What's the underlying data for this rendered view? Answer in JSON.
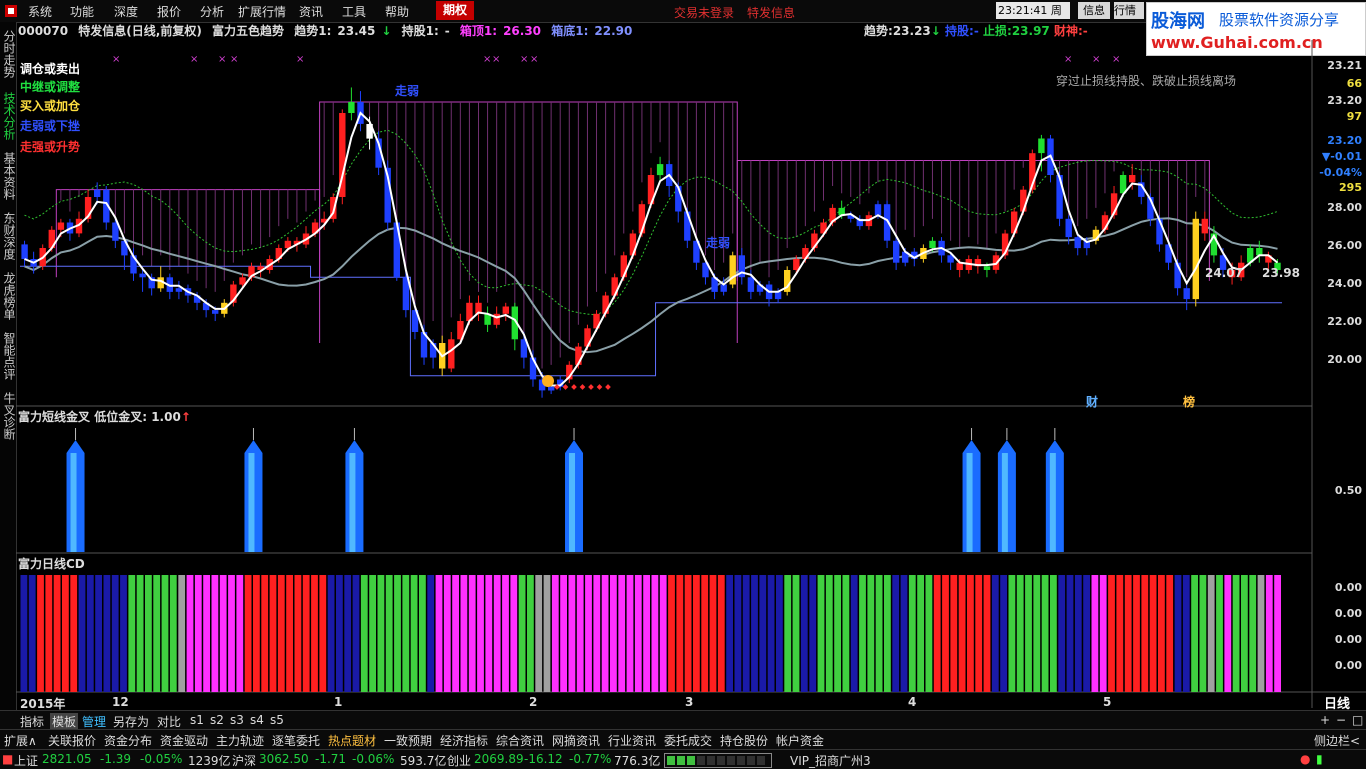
{
  "menu": {
    "items": [
      "系统",
      "功能",
      "深度",
      "报价",
      "分析",
      "扩展行情",
      "资讯",
      "工具",
      "帮助"
    ],
    "futures_tab": "期权",
    "not_logged": "交易未登录",
    "special": "特发信息",
    "clock": "23:21:41",
    "weekday": "周日",
    "info_btn": "信息",
    "quote_btn": "行情"
  },
  "watermark": {
    "brand": "股海网",
    "slogan": "股票软件资源分享",
    "url": "www.Guhai.com.cn"
  },
  "left_tabs": [
    "分时走势",
    "技术分析",
    "基本资料",
    "东财深度",
    "龙虎榜单",
    "智能点评",
    "牛叉诊断"
  ],
  "info_line": {
    "code": "000070",
    "name": "特发信息(日线,前复权)",
    "indicator": "富力五色趋势",
    "trend1_label": "趋势1:",
    "trend1_value": "23.45",
    "hold1_label": "持股1:",
    "hold1_value": "-",
    "boxtop1_label": "箱顶1:",
    "boxtop1_value": "26.30",
    "boxbottom1_label": "箱底1:",
    "boxbottom1_value": "22.90",
    "trend_label": "趋势:",
    "trend_value": "23.23",
    "hold_label": "持股:",
    "hold_value": "-",
    "stop_label": "止损:",
    "stop_value": "23.97",
    "god_label": "财神:",
    "god_value": "-"
  },
  "legend": [
    {
      "text": "调仓或卖出",
      "color": "#ffffff"
    },
    {
      "text": "中继或调整",
      "color": "#20e040"
    },
    {
      "text": "买入或加仓",
      "color": "#ffe040"
    },
    {
      "text": "走弱或下挫",
      "color": "#3050ff"
    },
    {
      "text": "走强或升势",
      "color": "#ff3030"
    }
  ],
  "annotations": {
    "note": "穿过止损线持股、跌破止损线离场",
    "weak1": "走弱",
    "weak2": "走弱",
    "label_a": "24.07",
    "label_b": "23.98",
    "finance_mark": "财",
    "rank_mark": "榜"
  },
  "price_axis": [
    "23.21",
    "66",
    "23.20",
    "97",
    "23.20",
    "-0.01",
    "-0.04%",
    "295",
    "28.00",
    "26.00",
    "24.00",
    "22.00",
    "20.00"
  ],
  "panel2": {
    "title": "富力短线金叉",
    "sub_label": "低位金叉:",
    "sub_value": "1.00",
    "axis": "0.50"
  },
  "panel3": {
    "title": "富力日线CD",
    "axis": [
      "0.00",
      "0.00",
      "0.00",
      "0.00"
    ]
  },
  "date_axis": {
    "year": "2015年",
    "labels": [
      "12",
      "1",
      "2",
      "3",
      "4",
      "5"
    ],
    "period": "日线"
  },
  "toolbar": [
    "指标",
    "模板",
    "管理",
    "另存为",
    "对比",
    "s1",
    "s2",
    "s3",
    "s4",
    "s5"
  ],
  "toolbar_right": [
    "+",
    "−",
    "□"
  ],
  "bottom_tabs": [
    "扩展∧",
    "关联报价",
    "资金分布",
    "资金驱动",
    "主力轨迹",
    "逐笔委托",
    "热点题材",
    "一致预期",
    "经济指标",
    "综合资讯",
    "网摘资讯",
    "行业资讯",
    "委托成交",
    "持仓股份",
    "帐户资金"
  ],
  "bottom_right": "侧边栏<",
  "status": {
    "sh_label": "上证",
    "sh_value": "2821.05",
    "sh_change": "-1.39",
    "sh_pct": "-0.05%",
    "sh_amount": "1239亿",
    "hs_label": "沪深",
    "hs_value": "3062.50",
    "hs_change": "-1.71",
    "hs_pct": "-0.06%",
    "hs_amount": "593.7亿",
    "cy_label": "创业",
    "cy_value": "2069.89",
    "cy_change": "-16.12",
    "cy_pct": "-0.77%",
    "cy_amount": "776.3亿",
    "vip": "VIP_招商广州3"
  },
  "chart_data": {
    "type": "candlestick",
    "ylim": [
      19.5,
      29.5
    ],
    "candles": [
      [
        23.9,
        23.5,
        24.0,
        23.3,
        "b"
      ],
      [
        23.5,
        23.3,
        23.7,
        23.1,
        "b"
      ],
      [
        23.3,
        23.8,
        23.9,
        23.2,
        "r"
      ],
      [
        23.8,
        24.3,
        24.4,
        23.7,
        "r"
      ],
      [
        24.3,
        24.5,
        24.6,
        24.1,
        "r"
      ],
      [
        24.5,
        24.2,
        24.6,
        24.0,
        "b"
      ],
      [
        24.2,
        24.6,
        24.8,
        24.1,
        "r"
      ],
      [
        24.6,
        25.2,
        25.4,
        24.5,
        "r"
      ],
      [
        25.2,
        25.4,
        25.6,
        25.0,
        "b"
      ],
      [
        25.4,
        24.5,
        25.5,
        24.3,
        "b"
      ],
      [
        24.5,
        24.0,
        24.6,
        23.8,
        "b"
      ],
      [
        24.0,
        23.6,
        24.1,
        23.2,
        "b"
      ],
      [
        23.6,
        23.1,
        23.8,
        22.9,
        "b"
      ],
      [
        23.1,
        23.0,
        23.2,
        22.6,
        "b"
      ],
      [
        23.0,
        22.7,
        23.1,
        22.5,
        "b"
      ],
      [
        22.7,
        23.0,
        23.3,
        22.6,
        "y"
      ],
      [
        23.0,
        22.6,
        23.1,
        22.4,
        "b"
      ],
      [
        22.6,
        22.7,
        22.9,
        22.4,
        "b"
      ],
      [
        22.7,
        22.5,
        22.8,
        22.3,
        "b"
      ],
      [
        22.5,
        22.3,
        22.6,
        22.1,
        "b"
      ],
      [
        22.3,
        22.1,
        22.4,
        21.9,
        "b"
      ],
      [
        22.1,
        22.0,
        22.2,
        21.8,
        "b"
      ],
      [
        22.0,
        22.3,
        22.4,
        21.9,
        "y"
      ],
      [
        22.3,
        22.8,
        22.9,
        22.2,
        "r"
      ],
      [
        22.8,
        23.0,
        23.1,
        22.7,
        "r"
      ],
      [
        23.0,
        23.3,
        23.4,
        22.9,
        "r"
      ],
      [
        23.3,
        23.2,
        23.4,
        23.0,
        "r"
      ],
      [
        23.2,
        23.5,
        23.6,
        23.1,
        "r"
      ],
      [
        23.5,
        23.8,
        23.9,
        23.4,
        "r"
      ],
      [
        23.8,
        24.0,
        24.1,
        23.7,
        "r"
      ],
      [
        24.0,
        23.9,
        24.1,
        23.7,
        "r"
      ],
      [
        23.9,
        24.2,
        24.4,
        23.8,
        "r"
      ],
      [
        24.2,
        24.5,
        24.6,
        24.1,
        "r"
      ],
      [
        24.5,
        24.6,
        24.8,
        24.3,
        "r"
      ],
      [
        24.6,
        25.2,
        25.3,
        24.5,
        "r"
      ],
      [
        25.2,
        27.5,
        27.6,
        25.0,
        "r"
      ],
      [
        27.5,
        27.8,
        28.2,
        27.3,
        "g"
      ],
      [
        27.8,
        27.2,
        28.1,
        27.0,
        "b"
      ],
      [
        27.2,
        26.8,
        27.4,
        26.5,
        "w"
      ],
      [
        26.8,
        26.0,
        27.0,
        25.8,
        "b"
      ],
      [
        26.0,
        24.5,
        26.2,
        24.3,
        "b"
      ],
      [
        24.5,
        23.0,
        24.6,
        22.9,
        "b"
      ],
      [
        23.0,
        22.1,
        23.2,
        21.9,
        "b"
      ],
      [
        22.1,
        21.5,
        22.3,
        21.3,
        "b"
      ],
      [
        21.5,
        20.8,
        21.7,
        20.6,
        "b"
      ],
      [
        20.8,
        21.2,
        21.3,
        20.5,
        "b"
      ],
      [
        21.2,
        20.5,
        21.4,
        20.3,
        "y"
      ],
      [
        20.5,
        21.3,
        21.5,
        20.4,
        "r"
      ],
      [
        21.3,
        21.8,
        22.0,
        21.2,
        "r"
      ],
      [
        21.8,
        22.3,
        22.5,
        21.7,
        "r"
      ],
      [
        22.3,
        22.0,
        22.5,
        21.8,
        "r"
      ],
      [
        22.0,
        21.7,
        22.2,
        21.5,
        "g"
      ],
      [
        21.7,
        22.0,
        22.2,
        21.6,
        "r"
      ],
      [
        22.0,
        22.2,
        22.3,
        21.8,
        "r"
      ],
      [
        22.2,
        21.3,
        22.3,
        21.0,
        "g"
      ],
      [
        21.3,
        20.8,
        21.5,
        20.5,
        "b"
      ],
      [
        20.8,
        20.2,
        21.0,
        20.0,
        "b"
      ],
      [
        20.2,
        19.9,
        20.4,
        19.7,
        "b"
      ],
      [
        19.9,
        20.0,
        20.2,
        19.8,
        "b"
      ],
      [
        20.0,
        20.2,
        20.3,
        19.9,
        "b"
      ],
      [
        20.2,
        20.6,
        20.7,
        20.1,
        "r"
      ],
      [
        20.6,
        21.1,
        21.2,
        20.5,
        "r"
      ],
      [
        21.1,
        21.6,
        21.7,
        21.0,
        "r"
      ],
      [
        21.6,
        22.0,
        22.1,
        21.5,
        "r"
      ],
      [
        22.0,
        22.5,
        22.6,
        21.9,
        "r"
      ],
      [
        22.5,
        23.0,
        23.1,
        22.4,
        "r"
      ],
      [
        23.0,
        23.6,
        23.7,
        22.9,
        "r"
      ],
      [
        23.6,
        24.2,
        24.3,
        23.5,
        "r"
      ],
      [
        24.2,
        25.0,
        25.1,
        24.1,
        "r"
      ],
      [
        25.0,
        25.8,
        26.0,
        24.9,
        "r"
      ],
      [
        25.8,
        26.1,
        26.3,
        25.6,
        "g"
      ],
      [
        26.1,
        25.5,
        26.2,
        25.2,
        "b"
      ],
      [
        25.5,
        24.8,
        25.6,
        24.5,
        "b"
      ],
      [
        24.8,
        24.0,
        24.9,
        23.8,
        "b"
      ],
      [
        24.0,
        23.4,
        24.1,
        23.2,
        "b"
      ],
      [
        23.4,
        23.0,
        23.5,
        22.8,
        "b"
      ],
      [
        23.0,
        22.6,
        23.1,
        22.4,
        "b"
      ],
      [
        22.6,
        22.8,
        23.0,
        22.5,
        "b"
      ],
      [
        22.8,
        23.6,
        23.7,
        22.7,
        "y"
      ],
      [
        23.6,
        23.0,
        23.8,
        22.8,
        "b"
      ],
      [
        23.0,
        22.6,
        23.2,
        22.4,
        "b"
      ],
      [
        22.6,
        22.8,
        22.9,
        22.5,
        "b"
      ],
      [
        22.8,
        22.4,
        22.9,
        22.2,
        "b"
      ],
      [
        22.4,
        22.6,
        22.7,
        22.3,
        "b"
      ],
      [
        22.6,
        23.2,
        23.3,
        22.5,
        "y"
      ],
      [
        23.2,
        23.5,
        23.6,
        23.1,
        "r"
      ],
      [
        23.5,
        23.8,
        23.9,
        23.4,
        "r"
      ],
      [
        23.8,
        24.2,
        24.3,
        23.7,
        "r"
      ],
      [
        24.2,
        24.5,
        24.6,
        24.1,
        "r"
      ],
      [
        24.5,
        24.9,
        25.0,
        24.4,
        "r"
      ],
      [
        24.9,
        24.7,
        25.1,
        24.6,
        "g"
      ],
      [
        24.7,
        24.6,
        24.8,
        24.5,
        "b"
      ],
      [
        24.6,
        24.4,
        24.7,
        24.3,
        "b"
      ],
      [
        24.4,
        24.7,
        24.8,
        24.3,
        "r"
      ],
      [
        24.7,
        25.0,
        25.1,
        24.6,
        "b"
      ],
      [
        25.0,
        24.0,
        25.1,
        23.8,
        "b"
      ],
      [
        24.0,
        23.4,
        24.1,
        23.2,
        "b"
      ],
      [
        23.4,
        23.7,
        23.8,
        23.3,
        "b"
      ],
      [
        23.7,
        23.5,
        23.8,
        23.3,
        "b"
      ],
      [
        23.5,
        23.8,
        23.9,
        23.4,
        "y"
      ],
      [
        23.8,
        24.0,
        24.1,
        23.7,
        "g"
      ],
      [
        24.0,
        23.6,
        24.1,
        23.4,
        "b"
      ],
      [
        23.6,
        23.4,
        23.7,
        23.2,
        "b"
      ],
      [
        23.4,
        23.2,
        23.5,
        23.0,
        "r"
      ],
      [
        23.2,
        23.5,
        23.6,
        23.1,
        "r"
      ],
      [
        23.5,
        23.3,
        23.6,
        23.1,
        "r"
      ],
      [
        23.3,
        23.2,
        23.4,
        23.0,
        "g"
      ],
      [
        23.2,
        23.6,
        23.7,
        23.1,
        "r"
      ],
      [
        23.6,
        24.2,
        24.3,
        23.5,
        "r"
      ],
      [
        24.2,
        24.8,
        24.9,
        24.1,
        "r"
      ],
      [
        24.8,
        25.4,
        25.5,
        24.7,
        "r"
      ],
      [
        25.4,
        26.4,
        26.5,
        25.3,
        "r"
      ],
      [
        26.4,
        26.8,
        26.9,
        25.9,
        "g"
      ],
      [
        26.8,
        25.8,
        26.9,
        25.6,
        "b"
      ],
      [
        25.8,
        24.6,
        25.9,
        24.4,
        "b"
      ],
      [
        24.6,
        24.1,
        24.7,
        23.9,
        "b"
      ],
      [
        24.1,
        23.8,
        24.2,
        23.6,
        "b"
      ],
      [
        23.8,
        24.0,
        24.1,
        23.6,
        "b"
      ],
      [
        24.0,
        24.3,
        24.4,
        23.9,
        "y"
      ],
      [
        24.3,
        24.7,
        24.8,
        24.2,
        "r"
      ],
      [
        24.7,
        25.3,
        25.5,
        24.6,
        "r"
      ],
      [
        25.3,
        25.8,
        25.9,
        25.2,
        "g"
      ],
      [
        25.8,
        25.6,
        26.1,
        25.4,
        "r"
      ],
      [
        25.6,
        25.2,
        25.8,
        25.0,
        "b"
      ],
      [
        25.2,
        24.6,
        25.3,
        24.4,
        "b"
      ],
      [
        24.6,
        23.9,
        24.7,
        23.7,
        "b"
      ],
      [
        23.9,
        23.4,
        24.0,
        23.2,
        "b"
      ],
      [
        23.4,
        22.7,
        23.5,
        22.5,
        "b"
      ],
      [
        22.7,
        22.4,
        22.9,
        22.1,
        "b"
      ],
      [
        22.4,
        24.6,
        24.8,
        22.2,
        "y"
      ],
      [
        24.6,
        24.2,
        24.8,
        24.0,
        "r"
      ],
      [
        24.2,
        23.6,
        24.4,
        23.4,
        "g"
      ],
      [
        23.6,
        23.2,
        23.8,
        23.0,
        "b"
      ],
      [
        23.2,
        23.0,
        23.4,
        22.8,
        "r"
      ],
      [
        23.0,
        23.4,
        23.6,
        22.9,
        "r"
      ],
      [
        23.4,
        23.8,
        23.9,
        23.3,
        "g"
      ],
      [
        23.8,
        23.6,
        24.0,
        23.4,
        "g"
      ],
      [
        23.6,
        23.4,
        23.7,
        23.2,
        "r"
      ],
      [
        23.4,
        23.2,
        23.5,
        23.1,
        "g"
      ]
    ],
    "signals_panel2": [
      0.044,
      0.185,
      0.265,
      0.439,
      0.754,
      0.782,
      0.82
    ],
    "cd_colors": "bbrrrrrbbbbbbggggggsmmmmmmmrrrrrrrrrrbbbbggggggggbmmmmmmmmmmggssmmmmmmmmmmmmmmrrrrrrrbbbbbbbggbbggggbggggbbgggrrrrrrrbbggggggbbbbmmrrrrrrrrbbggsgmgggsmm"
  }
}
